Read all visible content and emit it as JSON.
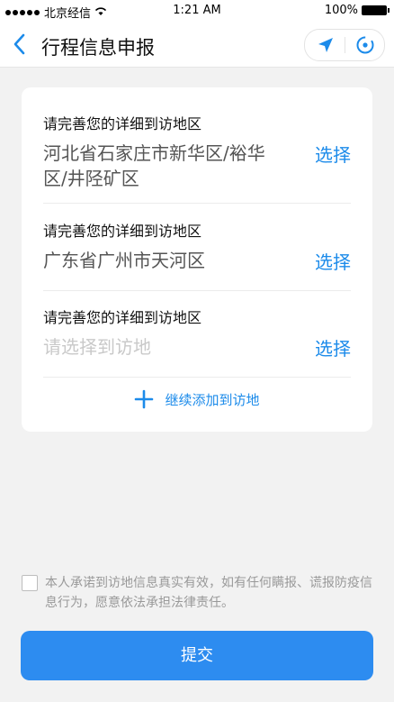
{
  "status_bar": {
    "carrier": "北京经信",
    "time": "1:21 AM",
    "battery": "100%"
  },
  "nav": {
    "title": "行程信息申报"
  },
  "entries": [
    {
      "label": "请完善您的详细到访地区",
      "value": "河北省石家庄市新华区/裕华区/井陉矿区",
      "placeholder": false,
      "action": "选择"
    },
    {
      "label": "请完善您的详细到访地区",
      "value": "广东省广州市天河区",
      "placeholder": false,
      "action": "选择"
    },
    {
      "label": "请完善您的详细到访地区",
      "value": "请选择到访地",
      "placeholder": true,
      "action": "选择"
    }
  ],
  "add_more": "继续添加到访地",
  "agreement": {
    "checked": false,
    "text": "本人承诺到访地信息真实有效，如有任何瞒报、谎报防疫信息行为，愿意依法承担法律责任。"
  },
  "submit_label": "提交",
  "colors": {
    "accent": "#1c8bea",
    "button": "#2d8cf0",
    "background": "#f2f2f2"
  }
}
